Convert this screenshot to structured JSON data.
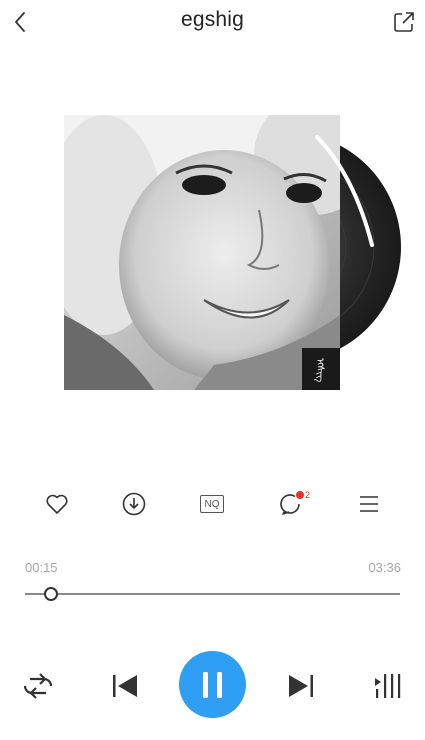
{
  "header": {
    "title": "egshig"
  },
  "album": {
    "cover_caption": "ᠡᠭᠰᠢᠭ"
  },
  "actions": {
    "quality_label": "NQ",
    "comment_count": "2"
  },
  "progress": {
    "current": "00:15",
    "total": "03:36",
    "fraction": 0.069
  },
  "colors": {
    "accent": "#2e9ff4",
    "badge": "#e8322f"
  },
  "controls": {
    "repeat_icon": "repeat-icon",
    "prev_icon": "previous-icon",
    "pause_icon": "pause-icon",
    "next_icon": "next-icon",
    "playlist_icon": "play-queue-icon"
  }
}
